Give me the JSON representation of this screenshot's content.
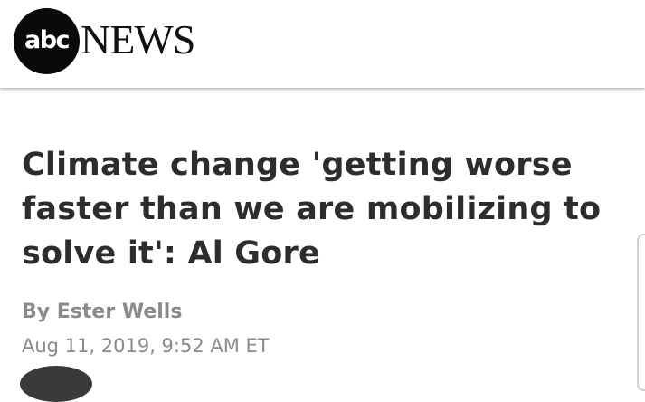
{
  "header": {
    "logo": {
      "badge_text": "abc",
      "wordmark": "NEWS"
    }
  },
  "article": {
    "headline": "Climate change 'getting worse faster than we are mobilizing to solve it': Al Gore",
    "byline": "By Ester Wells",
    "timestamp": "Aug 11, 2019, 9:52 AM ET"
  },
  "colors": {
    "headline": "#2d2d2d",
    "meta": "#8a8a8a",
    "logo_badge": "#0a0a0a"
  }
}
